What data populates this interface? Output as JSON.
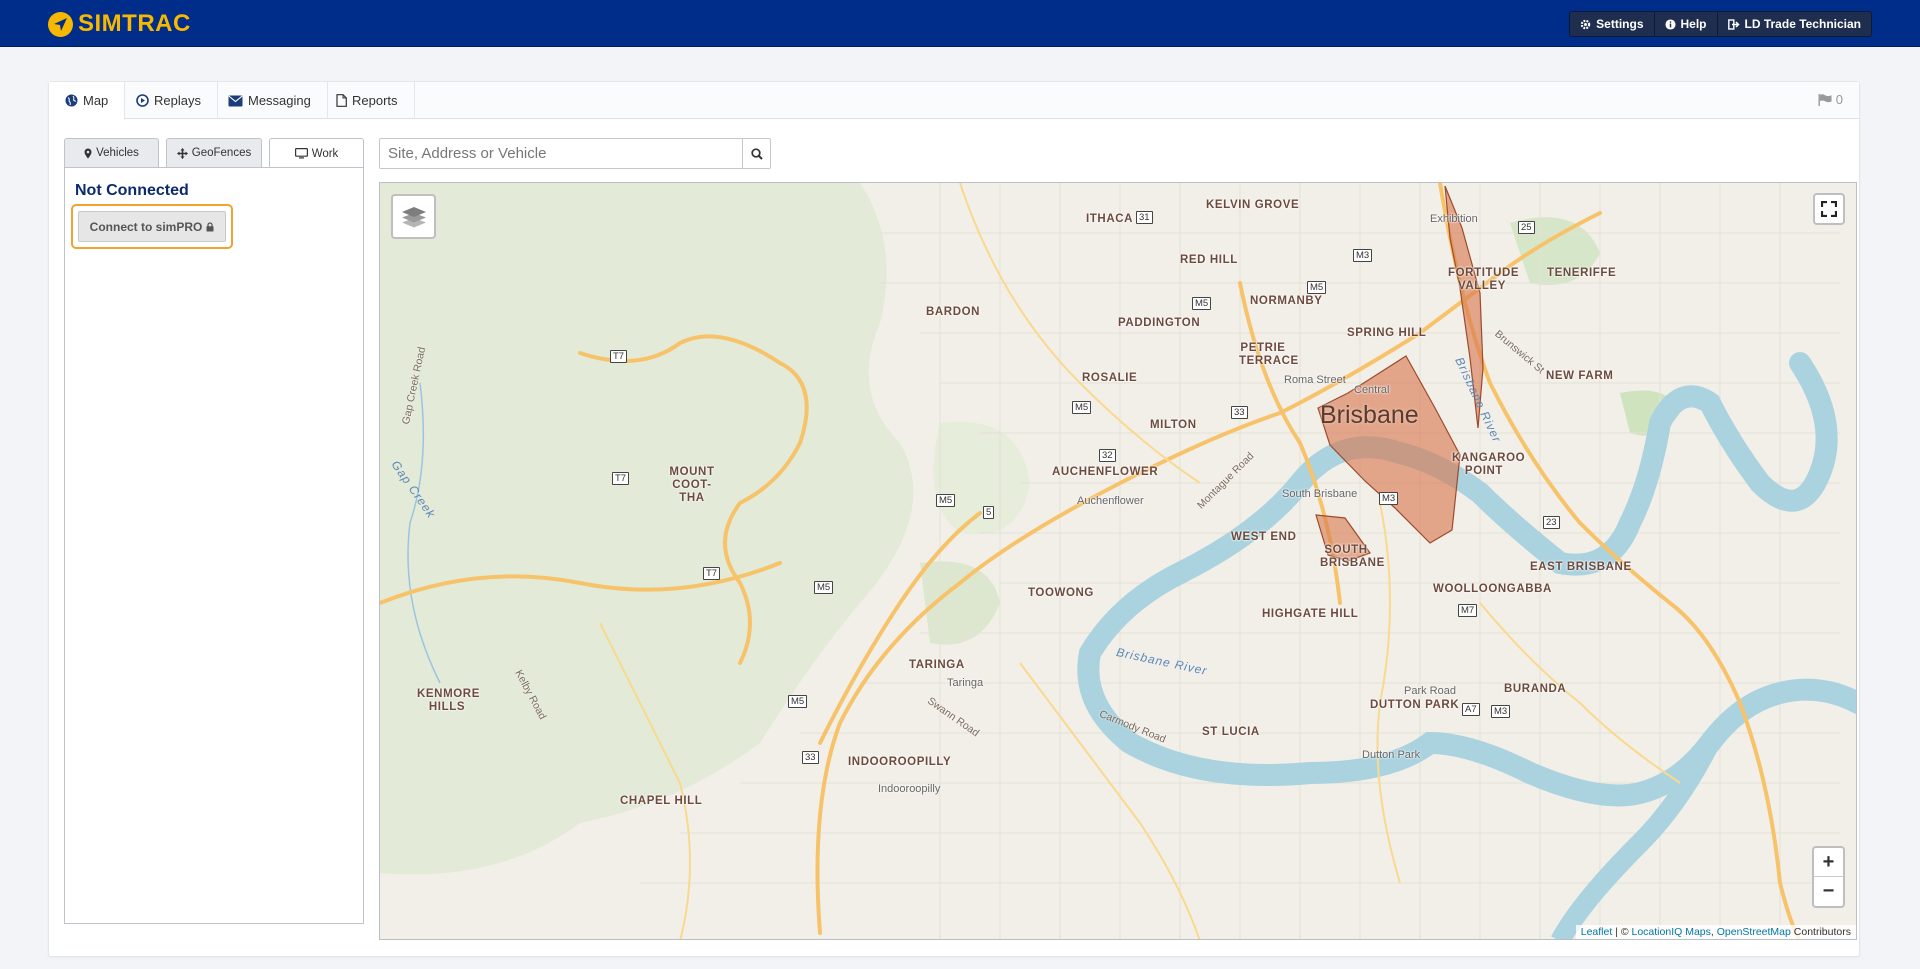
{
  "header": {
    "logo_text": "SIMTRAC",
    "nav": [
      {
        "label": "Settings",
        "icon": "gear-icon"
      },
      {
        "label": "Help",
        "icon": "info-icon"
      },
      {
        "label": "LD Trade Technician",
        "icon": "sign-out-icon"
      }
    ]
  },
  "tabs": [
    {
      "label": "Map",
      "icon": "globe-icon"
    },
    {
      "label": "Replays",
      "icon": "play-circle-icon"
    },
    {
      "label": "Messaging",
      "icon": "envelope-icon"
    },
    {
      "label": "Reports",
      "icon": "file-icon"
    }
  ],
  "flag_count": "0",
  "subtabs": [
    {
      "label": "Vehicles",
      "icon": "map-marker-icon"
    },
    {
      "label": "GeoFences",
      "icon": "arrows-icon"
    },
    {
      "label": "Work",
      "icon": "monitor-icon"
    }
  ],
  "work": {
    "status": "Not Connected",
    "connect_label": "Connect to simPRO"
  },
  "search": {
    "placeholder": "Site, Address or Vehicle"
  },
  "map": {
    "suburbs": [
      "ITHACA",
      "KELVIN GROVE",
      "RED HILL",
      "BARDON",
      "NORMANBY",
      "PADDINGTON",
      "FORTITUDE VALLEY",
      "SPRING HILL",
      "PETRIE TERRACE",
      "ROSALIE",
      "MILTON",
      "MOUNT COOT-THA",
      "AUCHENFLOWER",
      "KANGAROO POINT",
      "WEST END",
      "SOUTH BRISBANE",
      "WOOLLOONGABBA",
      "EAST BRISBANE",
      "TOOWONG",
      "HIGHGATE HILL",
      "TARINGA",
      "KENMORE HILLS",
      "ST LUCIA",
      "DUTTON PARK",
      "BURANDA",
      "INDOOROOPILLY",
      "CHAPEL HILL",
      "TENERIFFE",
      "NEW FARM"
    ],
    "city": "Brisbane",
    "places": [
      "Exhibition",
      "Roma Street",
      "Central",
      "South Brisbane",
      "Auchenflower",
      "Taringa",
      "Indooroopilly",
      "Park Road",
      "Dutton Park"
    ],
    "roads": [
      "Gap Creek Road",
      "Montague Road",
      "Kelby Road",
      "Swann Road",
      "Carmody Road",
      "Brunswick St"
    ],
    "creek": "Gap Creek",
    "river": "Brisbane River",
    "river2": "Brisbane River",
    "shields": [
      "31",
      "M3",
      "25",
      "M5",
      "T7",
      "33",
      "32",
      "M5",
      "5",
      "T7",
      "M5",
      "M5",
      "M3",
      "23",
      "M7",
      "A7",
      "M3",
      "33",
      "T7",
      "M5",
      "M5",
      "M5"
    ],
    "zoom_in": "+",
    "zoom_out": "−",
    "attribution": {
      "leaflet": "Leaflet",
      "sep": "| ©",
      "locationiq": "LocationIQ Maps",
      "comma": ",",
      "osm": "OpenStreetMap",
      "contrib": "Contributors"
    }
  },
  "colors": {
    "header_bg": "#002d8a",
    "logo": "#f6b800",
    "geofence": "#d9784e",
    "water": "#aad3df"
  }
}
